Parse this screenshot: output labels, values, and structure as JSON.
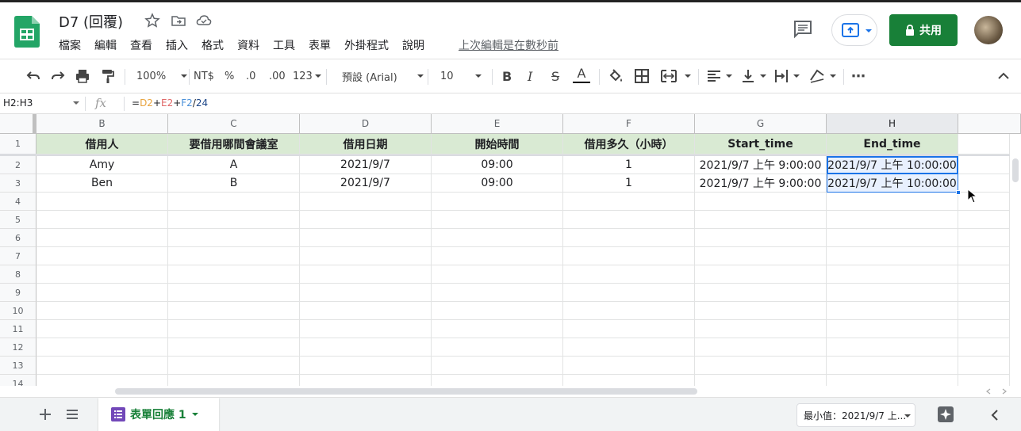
{
  "app": {
    "doc_title": "D7 (回覆)",
    "menu": [
      "檔案",
      "編輯",
      "查看",
      "插入",
      "格式",
      "資料",
      "工具",
      "表單",
      "外掛程式",
      "說明"
    ],
    "last_edit": "上次編輯是在數秒前",
    "share_label": "共用"
  },
  "toolbar": {
    "zoom": "100%",
    "currency": "NT$",
    "percent": "%",
    "decimal_less": ".0",
    "decimal_more": ".00",
    "number_format": "123",
    "font": "預設 (Arial)",
    "font_size": "10",
    "bold": "B",
    "italic": "I",
    "strike": "S",
    "text_color": "A",
    "more": "⋯"
  },
  "formula_bar": {
    "name_box": "H2:H3",
    "fx": "fx",
    "formula_parts": [
      {
        "text": "=",
        "color": "#202124"
      },
      {
        "text": "D2",
        "color": "#e8a33e"
      },
      {
        "text": "+",
        "color": "#202124"
      },
      {
        "text": "E2",
        "color": "#e06666"
      },
      {
        "text": "+",
        "color": "#202124"
      },
      {
        "text": "F2",
        "color": "#4a90d9"
      },
      {
        "text": "/",
        "color": "#202124"
      },
      {
        "text": "24",
        "color": "#1c4587"
      }
    ]
  },
  "grid": {
    "columns": [
      "B",
      "C",
      "D",
      "E",
      "F",
      "G",
      "H"
    ],
    "row_numbers": [
      "1",
      "2",
      "3",
      "4",
      "5",
      "6",
      "7",
      "8",
      "9",
      "10",
      "11",
      "12",
      "13",
      "14"
    ],
    "header_row": [
      "借用人",
      "要借用哪間會議室",
      "借用日期",
      "開始時間",
      "借用多久（小時）",
      "Start_time",
      "End_time"
    ],
    "rows": [
      [
        "Amy",
        "A",
        "2021/9/7",
        "09:00",
        "1",
        "2021/9/7 上午 9:00:00",
        "2021/9/7 上午 10:00:00"
      ],
      [
        "Ben",
        "B",
        "2021/9/7",
        "09:00",
        "1",
        "2021/9/7 上午 9:00:00",
        "2021/9/7 上午 10:00:00"
      ]
    ],
    "selected_column": "H"
  },
  "bottom": {
    "sheet_tab": "表單回應 1",
    "summary": "最小值：2021/9/7 上..."
  },
  "colors": {
    "brand_green": "#188038",
    "header_fill": "#d9ead3",
    "selection": "#e8f0fe",
    "selection_border": "#1a73e8"
  }
}
